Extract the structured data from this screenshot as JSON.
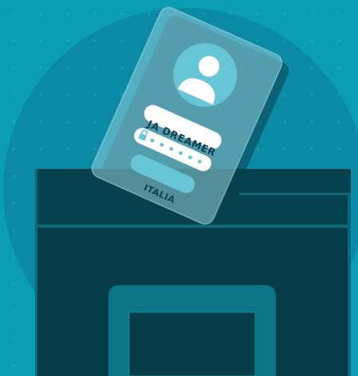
{
  "card": {
    "name": "JA DREAMER",
    "password_dots": 6,
    "country": "ITALIA"
  },
  "icons": {
    "avatar": "user-avatar-icon",
    "lock": "lock-icon"
  },
  "colors": {
    "background": "#0a9db3",
    "circle": "#0b8aa6",
    "box_dark": "#063b48",
    "card_glass": "#7fc4d0",
    "avatar_bg": "#67c6d6",
    "pill_white": "#ffffff",
    "text_dark": "#0d3f4c"
  }
}
